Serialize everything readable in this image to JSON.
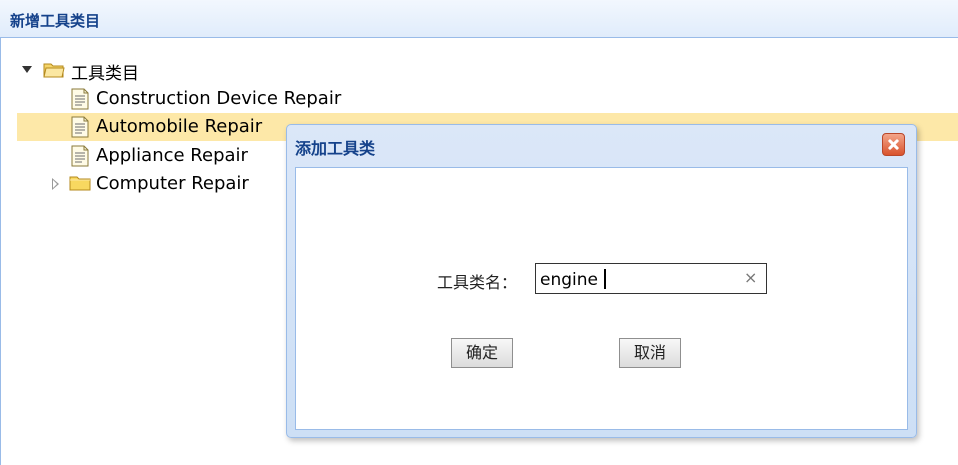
{
  "panel": {
    "title": "新增工具类目"
  },
  "tree": {
    "root": {
      "label": "工具类目",
      "expanded": true,
      "icon": "folder-open-icon"
    },
    "children": [
      {
        "label": "Construction Device Repair",
        "icon": "file-icon",
        "selected": false
      },
      {
        "label": "Automobile Repair",
        "icon": "file-icon",
        "selected": true
      },
      {
        "label": "Appliance Repair",
        "icon": "file-icon",
        "selected": false
      },
      {
        "label": "Computer Repair",
        "icon": "folder-icon",
        "expanded": false
      }
    ]
  },
  "dialog": {
    "title": "添加工具类",
    "field_label": "工具类名：",
    "input_value": "engine",
    "clear_symbol": "×",
    "confirm_label": "确定",
    "cancel_label": "取消"
  },
  "colors": {
    "header_text": "#15428b",
    "border": "#99bbe8",
    "selected_row": "#fde8a8",
    "close_button": "#d9532d"
  }
}
